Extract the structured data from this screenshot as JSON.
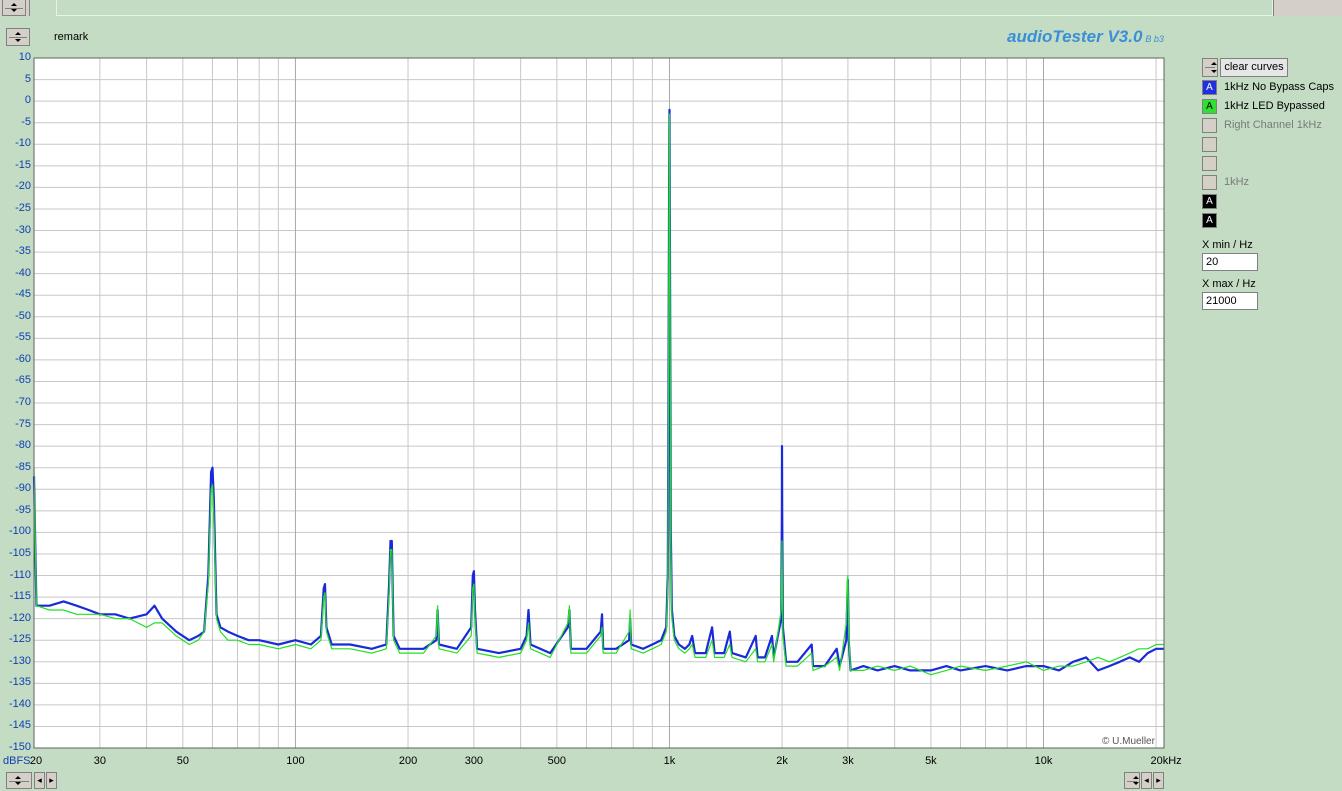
{
  "header": {
    "remark_label": "remark",
    "brand": "audioTester V3.0",
    "brand_version": "B b3"
  },
  "controls": {
    "clear_label": "clear curves"
  },
  "legend": [
    {
      "label": "1kHz No Bypass Caps",
      "box_text": "A",
      "color": "#2030e0",
      "enabled": true
    },
    {
      "label": "1kHz LED Bypassed",
      "box_text": "A",
      "color": "#30e030",
      "enabled": true
    },
    {
      "label": "Right Channel 1kHz",
      "box_text": "",
      "color": "#d4d0c8",
      "enabled": false
    },
    {
      "label": "",
      "box_text": "",
      "color": "#d4d0c8",
      "enabled": false
    },
    {
      "label": "",
      "box_text": "",
      "color": "#d4d0c8",
      "enabled": false
    },
    {
      "label": "1kHz",
      "box_text": "",
      "color": "#d4d0c8",
      "enabled": false
    },
    {
      "label": "",
      "box_text": "A",
      "color": "#000000",
      "enabled": true
    },
    {
      "label": "",
      "box_text": "A",
      "color": "#000000",
      "enabled": true
    }
  ],
  "xrange": {
    "min_label": "X min / Hz",
    "min_value": "20",
    "max_label": "X max / Hz",
    "max_value": "21000"
  },
  "copyright": "© U.Mueller",
  "chart_data": {
    "type": "line",
    "title": "",
    "xlabel": "",
    "ylabel": "dBFS",
    "xscale": "log",
    "xlim": [
      20,
      21000
    ],
    "ylim": [
      -150,
      10
    ],
    "grid": true,
    "y_ticks": [
      "10",
      "5",
      "0",
      "-5",
      "-10",
      "-15",
      "-20",
      "-25",
      "-30",
      "-35",
      "-40",
      "-45",
      "-50",
      "-55",
      "-60",
      "-65",
      "-70",
      "-75",
      "-80",
      "-85",
      "-90",
      "-95",
      "-100",
      "-105",
      "-110",
      "-115",
      "-120",
      "-125",
      "-130",
      "-135",
      "-140",
      "-145",
      "-150"
    ],
    "x_ticks": [
      {
        "v": 20,
        "t": "20"
      },
      {
        "v": 30,
        "t": "30"
      },
      {
        "v": 50,
        "t": "50"
      },
      {
        "v": 100,
        "t": "100"
      },
      {
        "v": 200,
        "t": "200"
      },
      {
        "v": 300,
        "t": "300"
      },
      {
        "v": 500,
        "t": "500"
      },
      {
        "v": 1000,
        "t": "1k"
      },
      {
        "v": 2000,
        "t": "2k"
      },
      {
        "v": 3000,
        "t": "3k"
      },
      {
        "v": 5000,
        "t": "5k"
      },
      {
        "v": 10000,
        "t": "10k"
      },
      {
        "v": 20000,
        "t": "20kHz"
      }
    ],
    "series": [
      {
        "name": "1kHz No Bypass Caps",
        "color": "#1a2ad8",
        "width": 2.2,
        "points": [
          [
            20,
            -87
          ],
          [
            20.3,
            -117
          ],
          [
            22,
            -117
          ],
          [
            24,
            -116
          ],
          [
            26,
            -117
          ],
          [
            28,
            -118
          ],
          [
            30,
            -119
          ],
          [
            33,
            -119
          ],
          [
            36,
            -120
          ],
          [
            40,
            -119
          ],
          [
            42,
            -117
          ],
          [
            44,
            -120
          ],
          [
            48,
            -123
          ],
          [
            52,
            -125
          ],
          [
            55,
            -124
          ],
          [
            57,
            -123
          ],
          [
            58.5,
            -110
          ],
          [
            59.5,
            -86
          ],
          [
            60,
            -85
          ],
          [
            60.5,
            -92
          ],
          [
            61.5,
            -119
          ],
          [
            63,
            -122
          ],
          [
            66,
            -123
          ],
          [
            70,
            -124
          ],
          [
            75,
            -125
          ],
          [
            80,
            -125
          ],
          [
            90,
            -126
          ],
          [
            100,
            -125
          ],
          [
            110,
            -126
          ],
          [
            117,
            -124
          ],
          [
            119,
            -113
          ],
          [
            120,
            -112
          ],
          [
            121,
            -122
          ],
          [
            125,
            -126
          ],
          [
            140,
            -126
          ],
          [
            160,
            -127
          ],
          [
            175,
            -126
          ],
          [
            178,
            -112
          ],
          [
            179.5,
            -102
          ],
          [
            181,
            -102
          ],
          [
            183,
            -124
          ],
          [
            190,
            -127
          ],
          [
            220,
            -127
          ],
          [
            238,
            -125
          ],
          [
            240,
            -118
          ],
          [
            242,
            -126
          ],
          [
            270,
            -127
          ],
          [
            295,
            -122
          ],
          [
            298,
            -110
          ],
          [
            300,
            -109
          ],
          [
            302,
            -118
          ],
          [
            306,
            -127
          ],
          [
            350,
            -128
          ],
          [
            400,
            -127
          ],
          [
            415,
            -124
          ],
          [
            420,
            -118
          ],
          [
            425,
            -126
          ],
          [
            480,
            -128
          ],
          [
            535,
            -122
          ],
          [
            540,
            -118
          ],
          [
            545,
            -127
          ],
          [
            600,
            -127
          ],
          [
            655,
            -123
          ],
          [
            660,
            -119
          ],
          [
            665,
            -127
          ],
          [
            720,
            -127
          ],
          [
            780,
            -125
          ],
          [
            785,
            -120
          ],
          [
            790,
            -126
          ],
          [
            850,
            -127
          ],
          [
            900,
            -126
          ],
          [
            950,
            -125
          ],
          [
            980,
            -122
          ],
          [
            990,
            -110
          ],
          [
            995,
            -60
          ],
          [
            998,
            -20
          ],
          [
            1000,
            -2
          ],
          [
            1003,
            -30
          ],
          [
            1008,
            -100
          ],
          [
            1015,
            -118
          ],
          [
            1030,
            -124
          ],
          [
            1060,
            -126
          ],
          [
            1100,
            -127
          ],
          [
            1130,
            -126
          ],
          [
            1150,
            -124
          ],
          [
            1170,
            -128
          ],
          [
            1250,
            -128
          ],
          [
            1300,
            -122
          ],
          [
            1320,
            -128
          ],
          [
            1400,
            -128
          ],
          [
            1450,
            -123
          ],
          [
            1470,
            -128
          ],
          [
            1600,
            -129
          ],
          [
            1700,
            -124
          ],
          [
            1720,
            -129
          ],
          [
            1800,
            -129
          ],
          [
            1880,
            -124
          ],
          [
            1900,
            -129
          ],
          [
            1990,
            -120
          ],
          [
            1998,
            -95
          ],
          [
            2000,
            -80
          ],
          [
            2002,
            -95
          ],
          [
            2010,
            -122
          ],
          [
            2050,
            -130
          ],
          [
            2200,
            -130
          ],
          [
            2400,
            -126
          ],
          [
            2420,
            -131
          ],
          [
            2600,
            -131
          ],
          [
            2800,
            -127
          ],
          [
            2850,
            -131
          ],
          [
            2970,
            -125
          ],
          [
            2985,
            -117
          ],
          [
            3000,
            -111
          ],
          [
            3015,
            -125
          ],
          [
            3050,
            -132
          ],
          [
            3300,
            -131
          ],
          [
            3600,
            -132
          ],
          [
            4000,
            -131
          ],
          [
            4400,
            -132
          ],
          [
            5000,
            -132
          ],
          [
            5500,
            -131
          ],
          [
            6000,
            -132
          ],
          [
            7000,
            -131
          ],
          [
            8000,
            -132
          ],
          [
            9000,
            -131
          ],
          [
            10000,
            -131
          ],
          [
            11000,
            -132
          ],
          [
            12000,
            -130
          ],
          [
            13000,
            -129
          ],
          [
            14000,
            -132
          ],
          [
            15000,
            -131
          ],
          [
            16000,
            -130
          ],
          [
            17000,
            -129
          ],
          [
            18000,
            -130
          ],
          [
            19000,
            -128
          ],
          [
            20000,
            -127
          ],
          [
            21000,
            -127
          ]
        ]
      },
      {
        "name": "1kHz LED Bypassed",
        "color": "#22e022",
        "width": 1.2,
        "points": [
          [
            20,
            -85
          ],
          [
            20.3,
            -117
          ],
          [
            22,
            -118
          ],
          [
            24,
            -118
          ],
          [
            26,
            -119
          ],
          [
            28,
            -119
          ],
          [
            30,
            -119
          ],
          [
            33,
            -120
          ],
          [
            36,
            -120
          ],
          [
            40,
            -122
          ],
          [
            42,
            -121
          ],
          [
            44,
            -121
          ],
          [
            48,
            -124
          ],
          [
            52,
            -126
          ],
          [
            55,
            -125
          ],
          [
            57,
            -123
          ],
          [
            58.5,
            -112
          ],
          [
            59.5,
            -90
          ],
          [
            60,
            -89
          ],
          [
            60.5,
            -96
          ],
          [
            61.5,
            -120
          ],
          [
            63,
            -123
          ],
          [
            66,
            -125
          ],
          [
            70,
            -125
          ],
          [
            75,
            -126
          ],
          [
            80,
            -126
          ],
          [
            90,
            -127
          ],
          [
            100,
            -126
          ],
          [
            110,
            -127
          ],
          [
            117,
            -125
          ],
          [
            119,
            -115
          ],
          [
            120,
            -114
          ],
          [
            121,
            -123
          ],
          [
            125,
            -127
          ],
          [
            140,
            -127
          ],
          [
            160,
            -128
          ],
          [
            175,
            -127
          ],
          [
            178,
            -114
          ],
          [
            179.5,
            -104
          ],
          [
            181,
            -104
          ],
          [
            183,
            -125
          ],
          [
            190,
            -128
          ],
          [
            220,
            -128
          ],
          [
            238,
            -124
          ],
          [
            240,
            -117
          ],
          [
            242,
            -127
          ],
          [
            270,
            -128
          ],
          [
            295,
            -124
          ],
          [
            298,
            -113
          ],
          [
            300,
            -112
          ],
          [
            302,
            -120
          ],
          [
            306,
            -128
          ],
          [
            350,
            -129
          ],
          [
            400,
            -128
          ],
          [
            415,
            -125
          ],
          [
            420,
            -121
          ],
          [
            425,
            -127
          ],
          [
            480,
            -129
          ],
          [
            535,
            -121
          ],
          [
            540,
            -117
          ],
          [
            545,
            -128
          ],
          [
            600,
            -128
          ],
          [
            655,
            -124
          ],
          [
            660,
            -122
          ],
          [
            665,
            -128
          ],
          [
            720,
            -128
          ],
          [
            780,
            -123
          ],
          [
            785,
            -118
          ],
          [
            790,
            -127
          ],
          [
            850,
            -128
          ],
          [
            900,
            -127
          ],
          [
            950,
            -126
          ],
          [
            980,
            -123
          ],
          [
            990,
            -112
          ],
          [
            995,
            -62
          ],
          [
            998,
            -22
          ],
          [
            1000,
            -3
          ],
          [
            1003,
            -32
          ],
          [
            1008,
            -102
          ],
          [
            1015,
            -120
          ],
          [
            1030,
            -125
          ],
          [
            1060,
            -127
          ],
          [
            1100,
            -128
          ],
          [
            1130,
            -127
          ],
          [
            1150,
            -126
          ],
          [
            1170,
            -129
          ],
          [
            1250,
            -129
          ],
          [
            1300,
            -125
          ],
          [
            1320,
            -129
          ],
          [
            1400,
            -129
          ],
          [
            1450,
            -126
          ],
          [
            1470,
            -129
          ],
          [
            1600,
            -130
          ],
          [
            1700,
            -127
          ],
          [
            1720,
            -130
          ],
          [
            1800,
            -130
          ],
          [
            1880,
            -126
          ],
          [
            1900,
            -130
          ],
          [
            1990,
            -118
          ],
          [
            1998,
            -104
          ],
          [
            2000,
            -102
          ],
          [
            2002,
            -108
          ],
          [
            2010,
            -124
          ],
          [
            2050,
            -131
          ],
          [
            2200,
            -131
          ],
          [
            2400,
            -128
          ],
          [
            2420,
            -132
          ],
          [
            2600,
            -131
          ],
          [
            2800,
            -129
          ],
          [
            2850,
            -132
          ],
          [
            2970,
            -121
          ],
          [
            2985,
            -112
          ],
          [
            3000,
            -110
          ],
          [
            3015,
            -124
          ],
          [
            3050,
            -132
          ],
          [
            3300,
            -132
          ],
          [
            3600,
            -131
          ],
          [
            4000,
            -132
          ],
          [
            4400,
            -131
          ],
          [
            5000,
            -133
          ],
          [
            5500,
            -132
          ],
          [
            6000,
            -131
          ],
          [
            7000,
            -132
          ],
          [
            8000,
            -131
          ],
          [
            9000,
            -130
          ],
          [
            10000,
            -132
          ],
          [
            11000,
            -131
          ],
          [
            12000,
            -131
          ],
          [
            13000,
            -130
          ],
          [
            14000,
            -129
          ],
          [
            15000,
            -130
          ],
          [
            16000,
            -129
          ],
          [
            17000,
            -128
          ],
          [
            18000,
            -127
          ],
          [
            19000,
            -127
          ],
          [
            20000,
            -126
          ],
          [
            21000,
            -126
          ]
        ]
      }
    ]
  }
}
